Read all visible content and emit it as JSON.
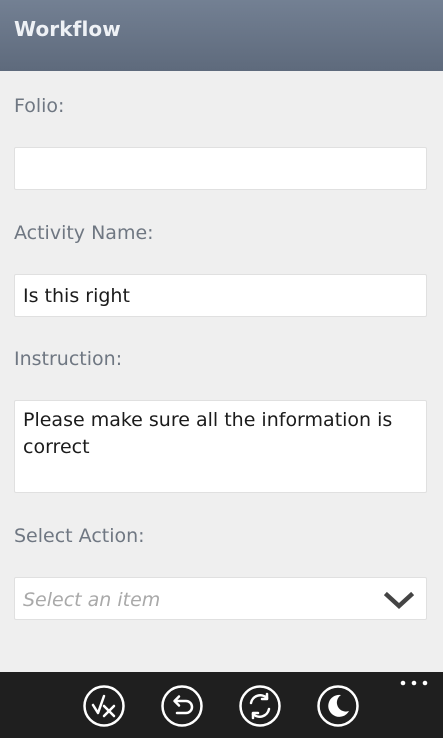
{
  "header": {
    "title": "Workflow"
  },
  "form": {
    "folio_label": "Folio:",
    "folio_value": "",
    "activity_label": "Activity Name:",
    "activity_value": "Is this right",
    "instruction_label": "Instruction:",
    "instruction_value": "Please make sure all the information is correct",
    "action_label": "Select Action:",
    "action_placeholder": "Select an item"
  },
  "appbar": {
    "buttons": [
      {
        "icon": "approve-reject-icon"
      },
      {
        "icon": "undo-icon"
      },
      {
        "icon": "refresh-icon"
      },
      {
        "icon": "sleep-icon"
      }
    ],
    "more_icon": "more-icon"
  },
  "colors": {
    "header_bg": "#6a7688",
    "content_bg": "#efefef",
    "appbar_bg": "#1f1f1f",
    "label_text": "#6f7782"
  }
}
